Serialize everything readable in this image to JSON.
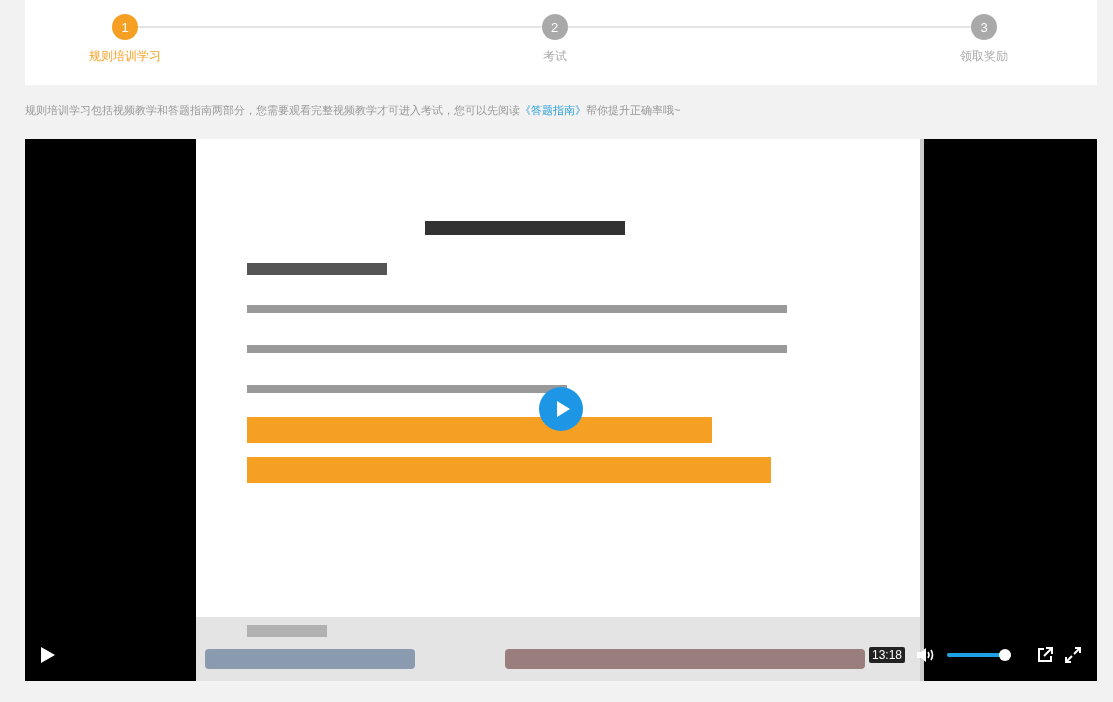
{
  "steps": [
    {
      "number": "1",
      "label": "规则培训学习",
      "selected": true
    },
    {
      "number": "2",
      "label": "考试",
      "selected": false
    },
    {
      "number": "3",
      "label": "领取奖励",
      "selected": false
    }
  ],
  "intro": {
    "text": "规则培训学习包括视频教学和答题指南两部分，您需要观看完整视频教学才可进入考试，您可以先阅读",
    "link": "《答题指南》",
    "after": "帮你提升正确率哦~"
  },
  "video": {
    "kind": "picture",
    "playing": false,
    "time": "13:18",
    "volume": {
      "level": 1.0
    }
  }
}
